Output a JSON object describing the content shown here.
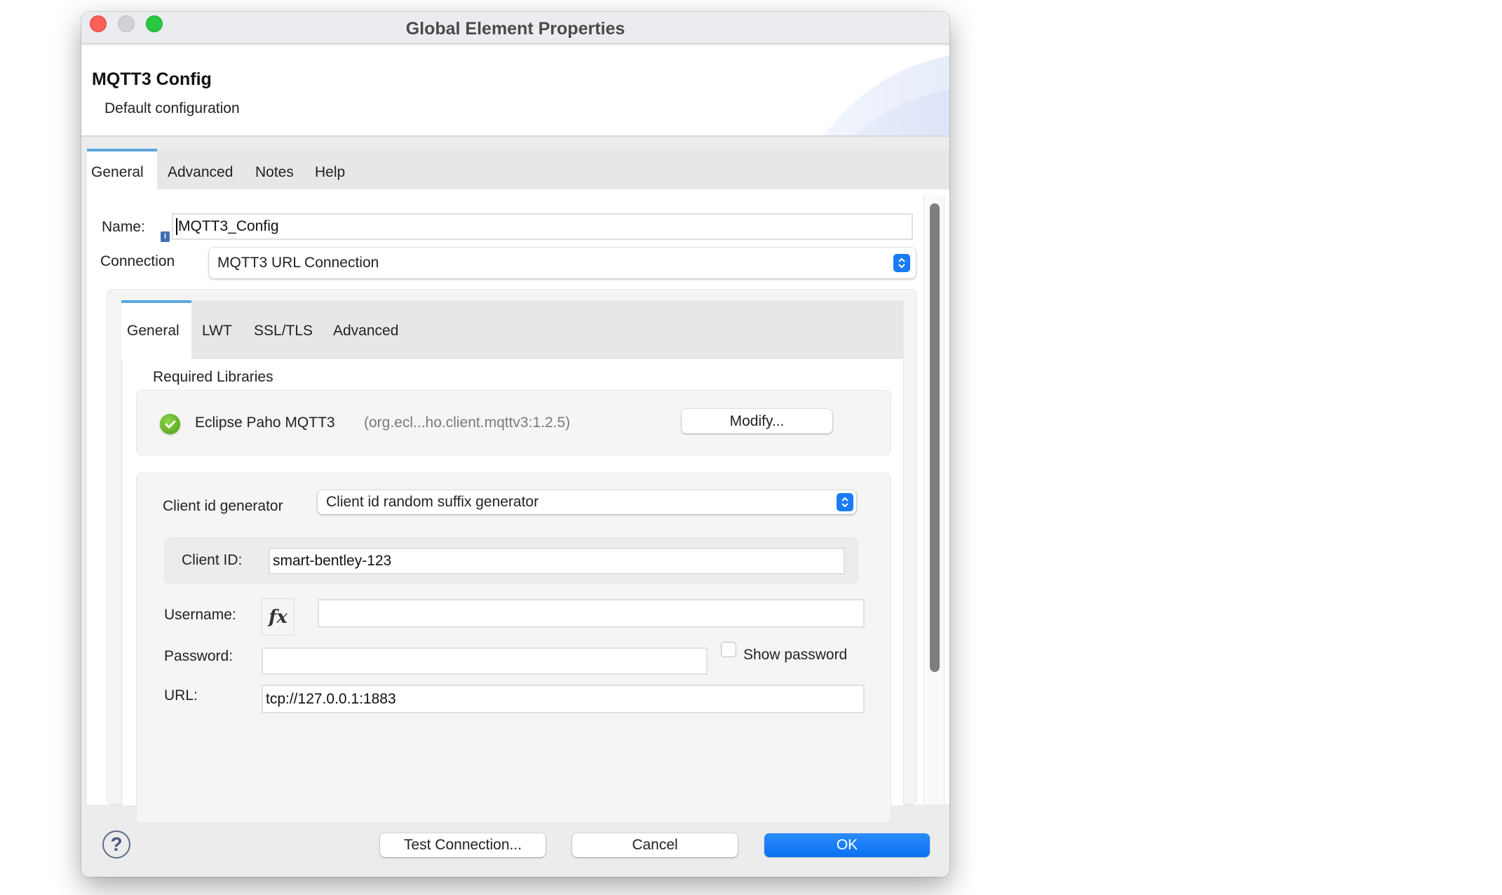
{
  "window": {
    "title": "Global Element Properties"
  },
  "header": {
    "title": "MQTT3 Config",
    "subtitle": "Default configuration"
  },
  "tabs": [
    {
      "label": "General",
      "active": true
    },
    {
      "label": "Advanced",
      "active": false
    },
    {
      "label": "Notes",
      "active": false
    },
    {
      "label": "Help",
      "active": false
    }
  ],
  "form": {
    "name_label": "Name:",
    "name_value": "MQTT3_Config",
    "info_icon": "i",
    "connection_label": "Connection",
    "connection_value": "MQTT3 URL Connection"
  },
  "inner_tabs": [
    {
      "label": "General",
      "active": true
    },
    {
      "label": "LWT",
      "active": false
    },
    {
      "label": "SSL/TLS",
      "active": false
    },
    {
      "label": "Advanced",
      "active": false
    }
  ],
  "libraries": {
    "section_label": "Required Libraries",
    "items": [
      {
        "status": "check-ok",
        "name": "Eclipse Paho MQTT3",
        "coordinates": "(org.ecl...ho.client.mqttv3:1.2.5)",
        "action_label": "Modify..."
      }
    ]
  },
  "settings": {
    "client_id_generator_label": "Client id generator",
    "client_id_generator_value": "Client id random suffix generator",
    "client_id_label": "Client ID:",
    "client_id_value": "smart-bentley-123",
    "username_label": "Username:",
    "username_value": "",
    "fx_label": "fx",
    "password_label": "Password:",
    "password_value": "",
    "show_password_label": "Show password",
    "show_password_checked": false,
    "url_label": "URL:",
    "url_value": "tcp://127.0.0.1:1883"
  },
  "footer": {
    "help_icon": "?",
    "test_connection_label": "Test Connection...",
    "cancel_label": "Cancel",
    "ok_label": "OK"
  },
  "colors": {
    "accent": "#0a70f0",
    "tab_indicator": "#5ba7dc",
    "close": "#fe5f57",
    "minimize": "#d2d2d6",
    "maximize": "#28c840",
    "success": "#5aac1e"
  }
}
